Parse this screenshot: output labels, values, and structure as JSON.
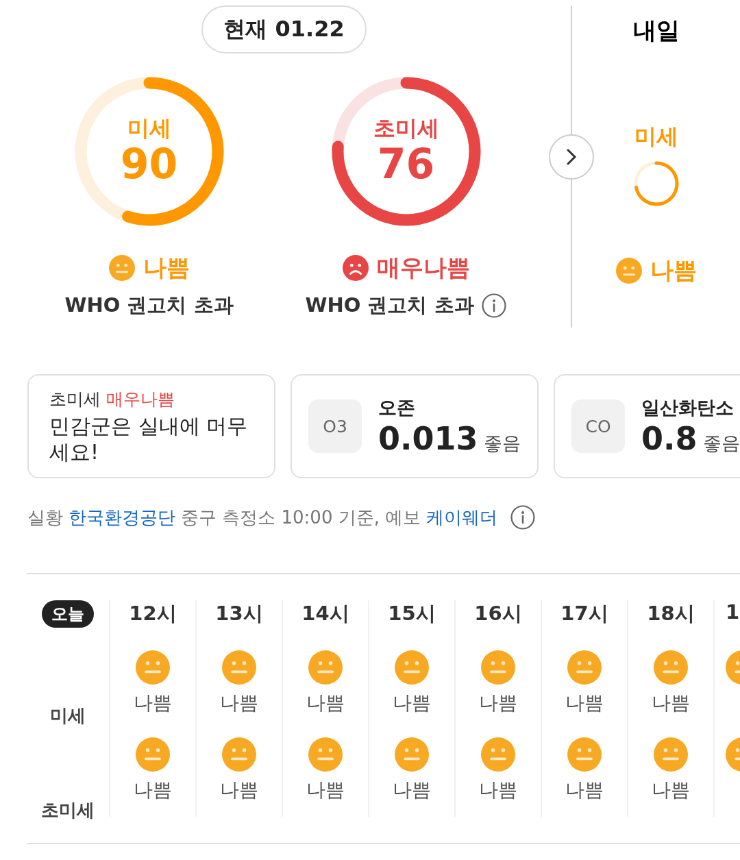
{
  "current": {
    "title": "현재 01.22",
    "gauges": [
      {
        "label": "미세",
        "value": "90",
        "kind": "bad",
        "level": 0.55,
        "status": "나쁨",
        "note": "WHO 권고치 초과",
        "info": false
      },
      {
        "label": "초미세",
        "value": "76",
        "kind": "very_bad",
        "level": 0.76,
        "status": "매우나쁨",
        "note": "WHO 권고치 초과",
        "info": true
      }
    ]
  },
  "tomorrow": {
    "title": "내일",
    "label": "미세",
    "kind": "bad",
    "status": "나쁨"
  },
  "alert": {
    "pollutant": "초미세",
    "kind": "very_bad",
    "grade_text": "매우나쁨",
    "message": "민감군은 실내에 머무세요!"
  },
  "gases": [
    {
      "symbol": "O3",
      "name": "오존",
      "value": "0.013",
      "status": "좋음"
    },
    {
      "symbol": "CO",
      "name": "일산화탄소",
      "value": "0.8",
      "status": "좋음"
    }
  ],
  "source": {
    "prefix": "실황",
    "provider": "한국환경공단",
    "middle": "중구 측정소 10:00 기준, 예보",
    "forecaster": "케이웨더"
  },
  "hourly": {
    "day": "오늘",
    "rows": [
      "미세",
      "초미세"
    ],
    "hours": [
      {
        "time": "12시",
        "values": [
          {
            "kind": "bad",
            "text": "나쁨"
          },
          {
            "kind": "bad",
            "text": "나쁨"
          }
        ]
      },
      {
        "time": "13시",
        "values": [
          {
            "kind": "bad",
            "text": "나쁨"
          },
          {
            "kind": "bad",
            "text": "나쁨"
          }
        ]
      },
      {
        "time": "14시",
        "values": [
          {
            "kind": "bad",
            "text": "나쁨"
          },
          {
            "kind": "bad",
            "text": "나쁨"
          }
        ]
      },
      {
        "time": "15시",
        "values": [
          {
            "kind": "bad",
            "text": "나쁨"
          },
          {
            "kind": "bad",
            "text": "나쁨"
          }
        ]
      },
      {
        "time": "16시",
        "values": [
          {
            "kind": "bad",
            "text": "나쁨"
          },
          {
            "kind": "bad",
            "text": "나쁨"
          }
        ]
      },
      {
        "time": "17시",
        "values": [
          {
            "kind": "bad",
            "text": "나쁨"
          },
          {
            "kind": "bad",
            "text": "나쁨"
          }
        ]
      },
      {
        "time": "18시",
        "values": [
          {
            "kind": "bad",
            "text": "나쁨"
          },
          {
            "kind": "bad",
            "text": "나쁨"
          }
        ]
      },
      {
        "time": "1",
        "values": [
          {
            "kind": "bad"
          },
          {
            "kind": "bad"
          }
        ]
      }
    ]
  }
}
